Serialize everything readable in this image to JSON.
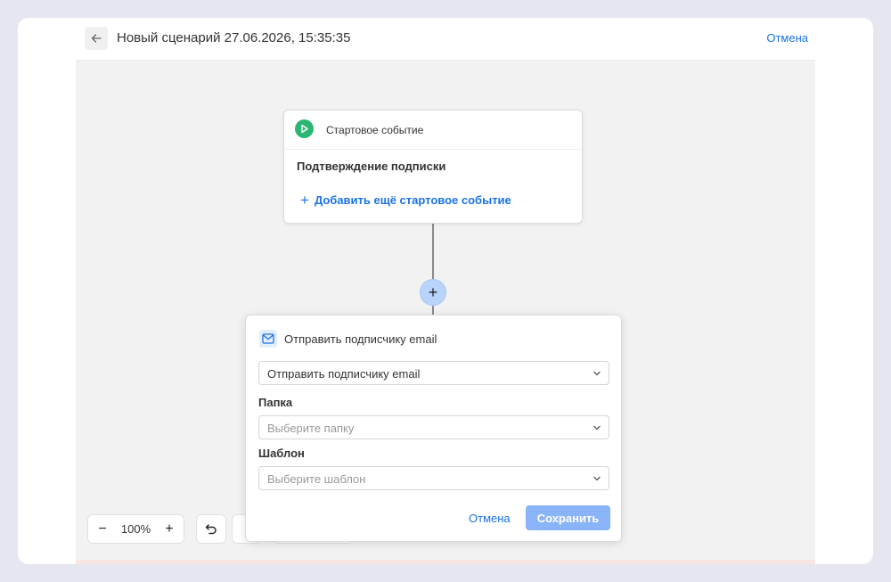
{
  "header": {
    "title": "Новый сценарий 27.06.2026, 15:35:35",
    "cancel_label": "Отмена"
  },
  "start_node": {
    "label": "Стартовое событие",
    "event": "Подтверждение подписки",
    "add_event_label": "Добавить ещё стартовое событие",
    "icon_color": "#2bb673"
  },
  "add_step": {
    "label": "+"
  },
  "zoom": {
    "minus_label": "−",
    "value": "100%",
    "plus_label": "+"
  },
  "action_panel": {
    "title": "Отправить подписчику email",
    "action_select": {
      "value": "Отправить подписчику email"
    },
    "folder": {
      "label": "Папка",
      "placeholder": "Выберите папку"
    },
    "template": {
      "label": "Шаблон",
      "placeholder": "Выберите шаблон"
    },
    "cancel_label": "Отмена",
    "save_label": "Сохранить"
  },
  "colors": {
    "accent": "#1a73e8",
    "save_disabled": "#8ab4f8",
    "add_node": "#b9d4fb",
    "canvas": "#f2f2f2"
  },
  "icons": [
    "arrow-left-icon",
    "play-icon",
    "plus-icon",
    "mail-icon",
    "chevron-down-icon",
    "undo-icon"
  ]
}
